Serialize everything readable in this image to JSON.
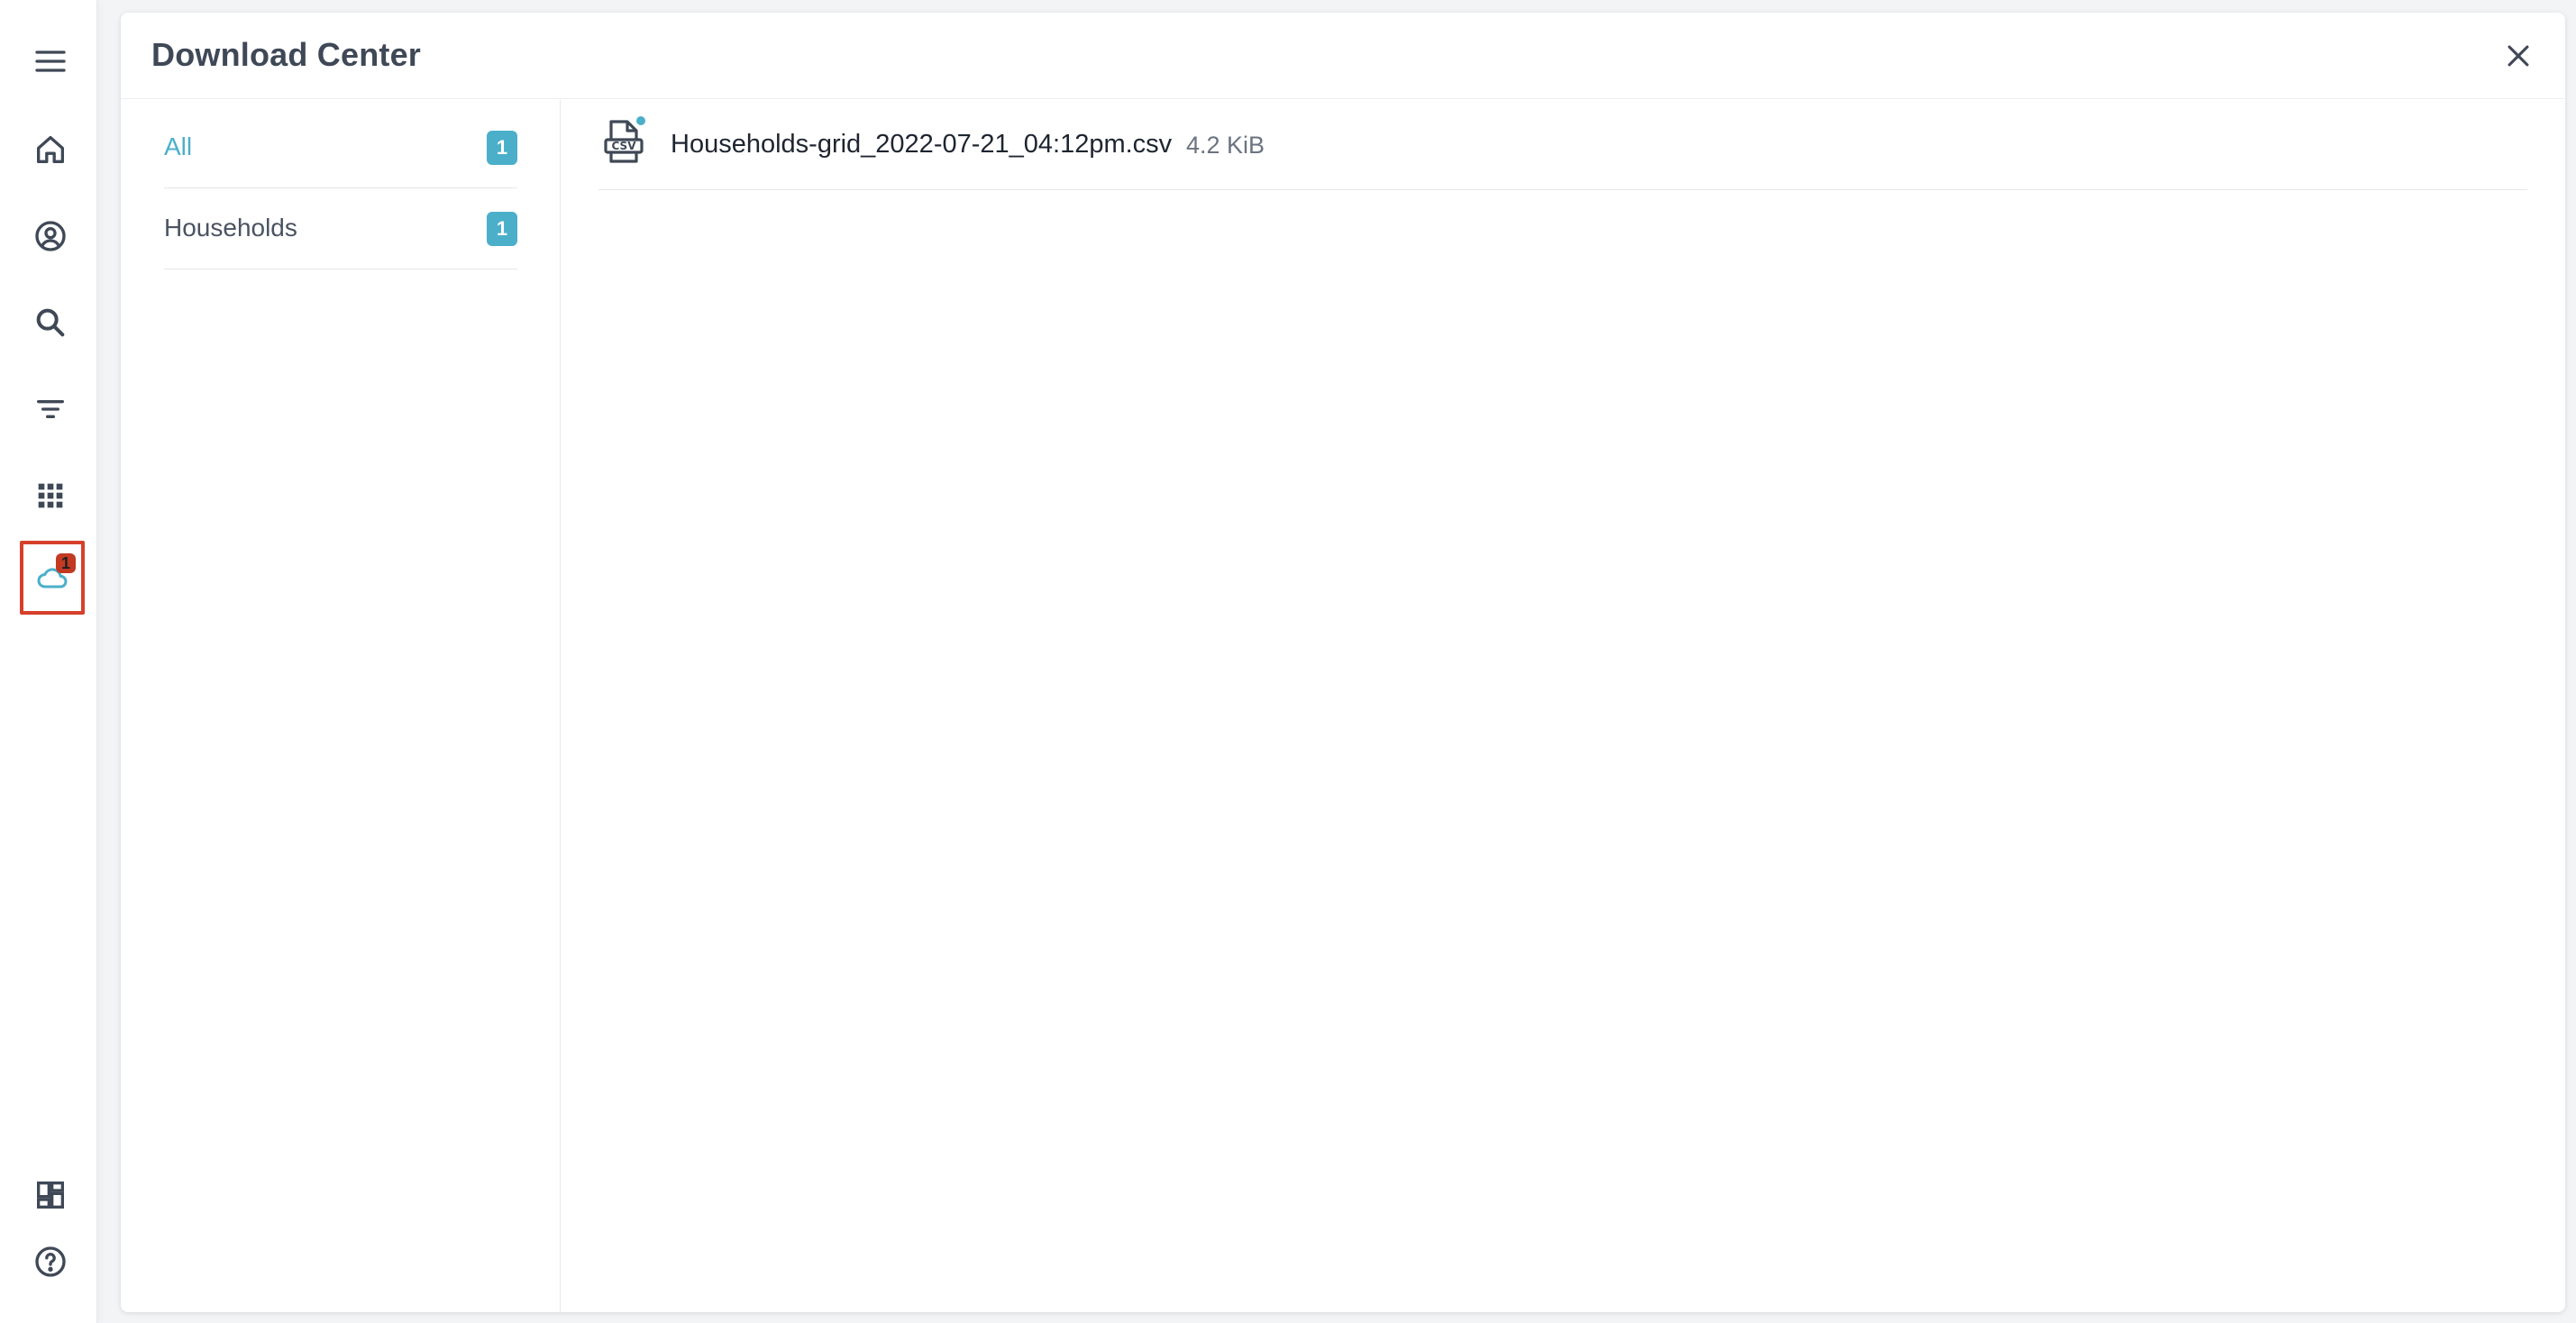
{
  "panel": {
    "title": "Download Center"
  },
  "rail": {
    "items": [
      {
        "name": "menu-icon"
      },
      {
        "name": "home-icon"
      },
      {
        "name": "account-icon"
      },
      {
        "name": "search-icon"
      },
      {
        "name": "filter-icon"
      },
      {
        "name": "apps-grid-icon"
      },
      {
        "name": "cloud-download-icon",
        "badge": "1"
      },
      {
        "name": "dashboard-icon"
      },
      {
        "name": "help-icon"
      }
    ]
  },
  "categories": [
    {
      "label": "All",
      "count": "1",
      "active": true
    },
    {
      "label": "Households",
      "count": "1",
      "active": false
    }
  ],
  "files": [
    {
      "name": "Households-grid_2022-07-21_04:12pm.csv",
      "size": "4.2 KiB",
      "icon": "csv-file-icon",
      "new": true
    }
  ],
  "colors": {
    "accent": "#4bafca",
    "highlight": "#d6402b",
    "badge": "#c23a22",
    "icon": "#3f4856"
  }
}
